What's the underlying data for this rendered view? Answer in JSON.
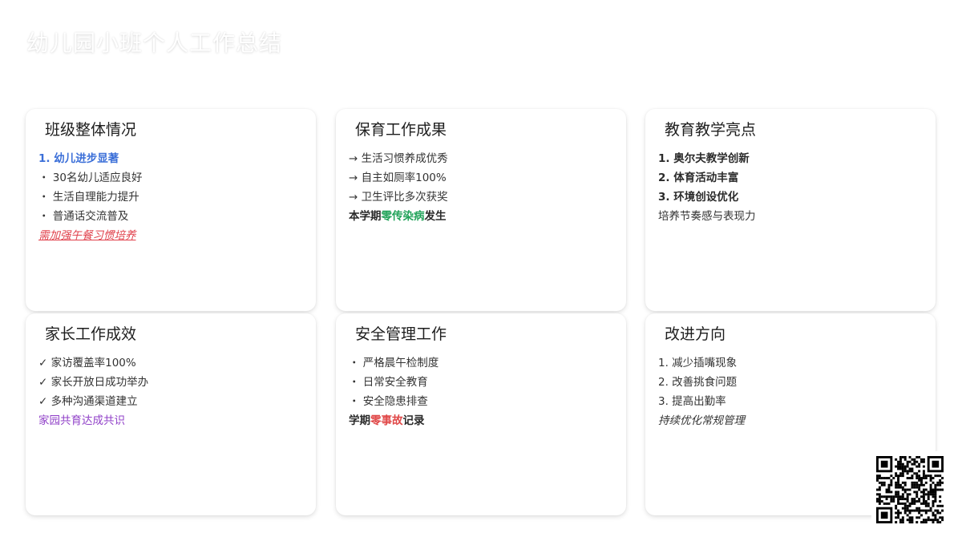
{
  "page": {
    "title": "幼儿园小班个人工作总结"
  },
  "cards": [
    {
      "title": "班级整体情况",
      "lines": [
        "1. 幼儿进步显著",
        "・ 30名幼儿适应良好",
        "・ 生活自理能力提升",
        "・ 普通话交流普及",
        "需加强午餐习惯培养"
      ]
    },
    {
      "title": "保育工作成果",
      "lines": [
        "→ 生活习惯养成优秀",
        "→ 自主如厕率100%",
        "→ 卫生评比多次获奖"
      ],
      "summary": {
        "prefix": "本学期",
        "highlight": "零传染病",
        "suffix": "发生"
      }
    },
    {
      "title": "教育教学亮点",
      "lines": [
        "1. 奥尔夫教学创新",
        "2. 体育活动丰富",
        "3. 环境创设优化",
        "培养节奏感与表现力"
      ]
    },
    {
      "title": "家长工作成效",
      "lines": [
        "✓ 家访覆盖率100%",
        "✓ 家长开放日成功举办",
        "✓ 多种沟通渠道建立",
        "家园共育达成共识"
      ]
    },
    {
      "title": "安全管理工作",
      "lines": [
        "・ 严格晨午检制度",
        "・ 日常安全教育",
        "・ 安全隐患排查"
      ],
      "summary": {
        "prefix": "学期",
        "highlight": "零事故",
        "suffix": "记录"
      }
    },
    {
      "title": "改进方向",
      "lines": [
        "1. 减少插嘴现象",
        "2. 改善挑食问题",
        "3. 提高出勤率",
        "持续优化常规管理"
      ]
    }
  ],
  "colors": {
    "accent_blue": "#3b6fd8",
    "accent_green": "#22a35a",
    "accent_red": "#e04848",
    "accent_purple": "#9040c8"
  },
  "icons": {
    "qr_code": "qr-code-icon"
  }
}
